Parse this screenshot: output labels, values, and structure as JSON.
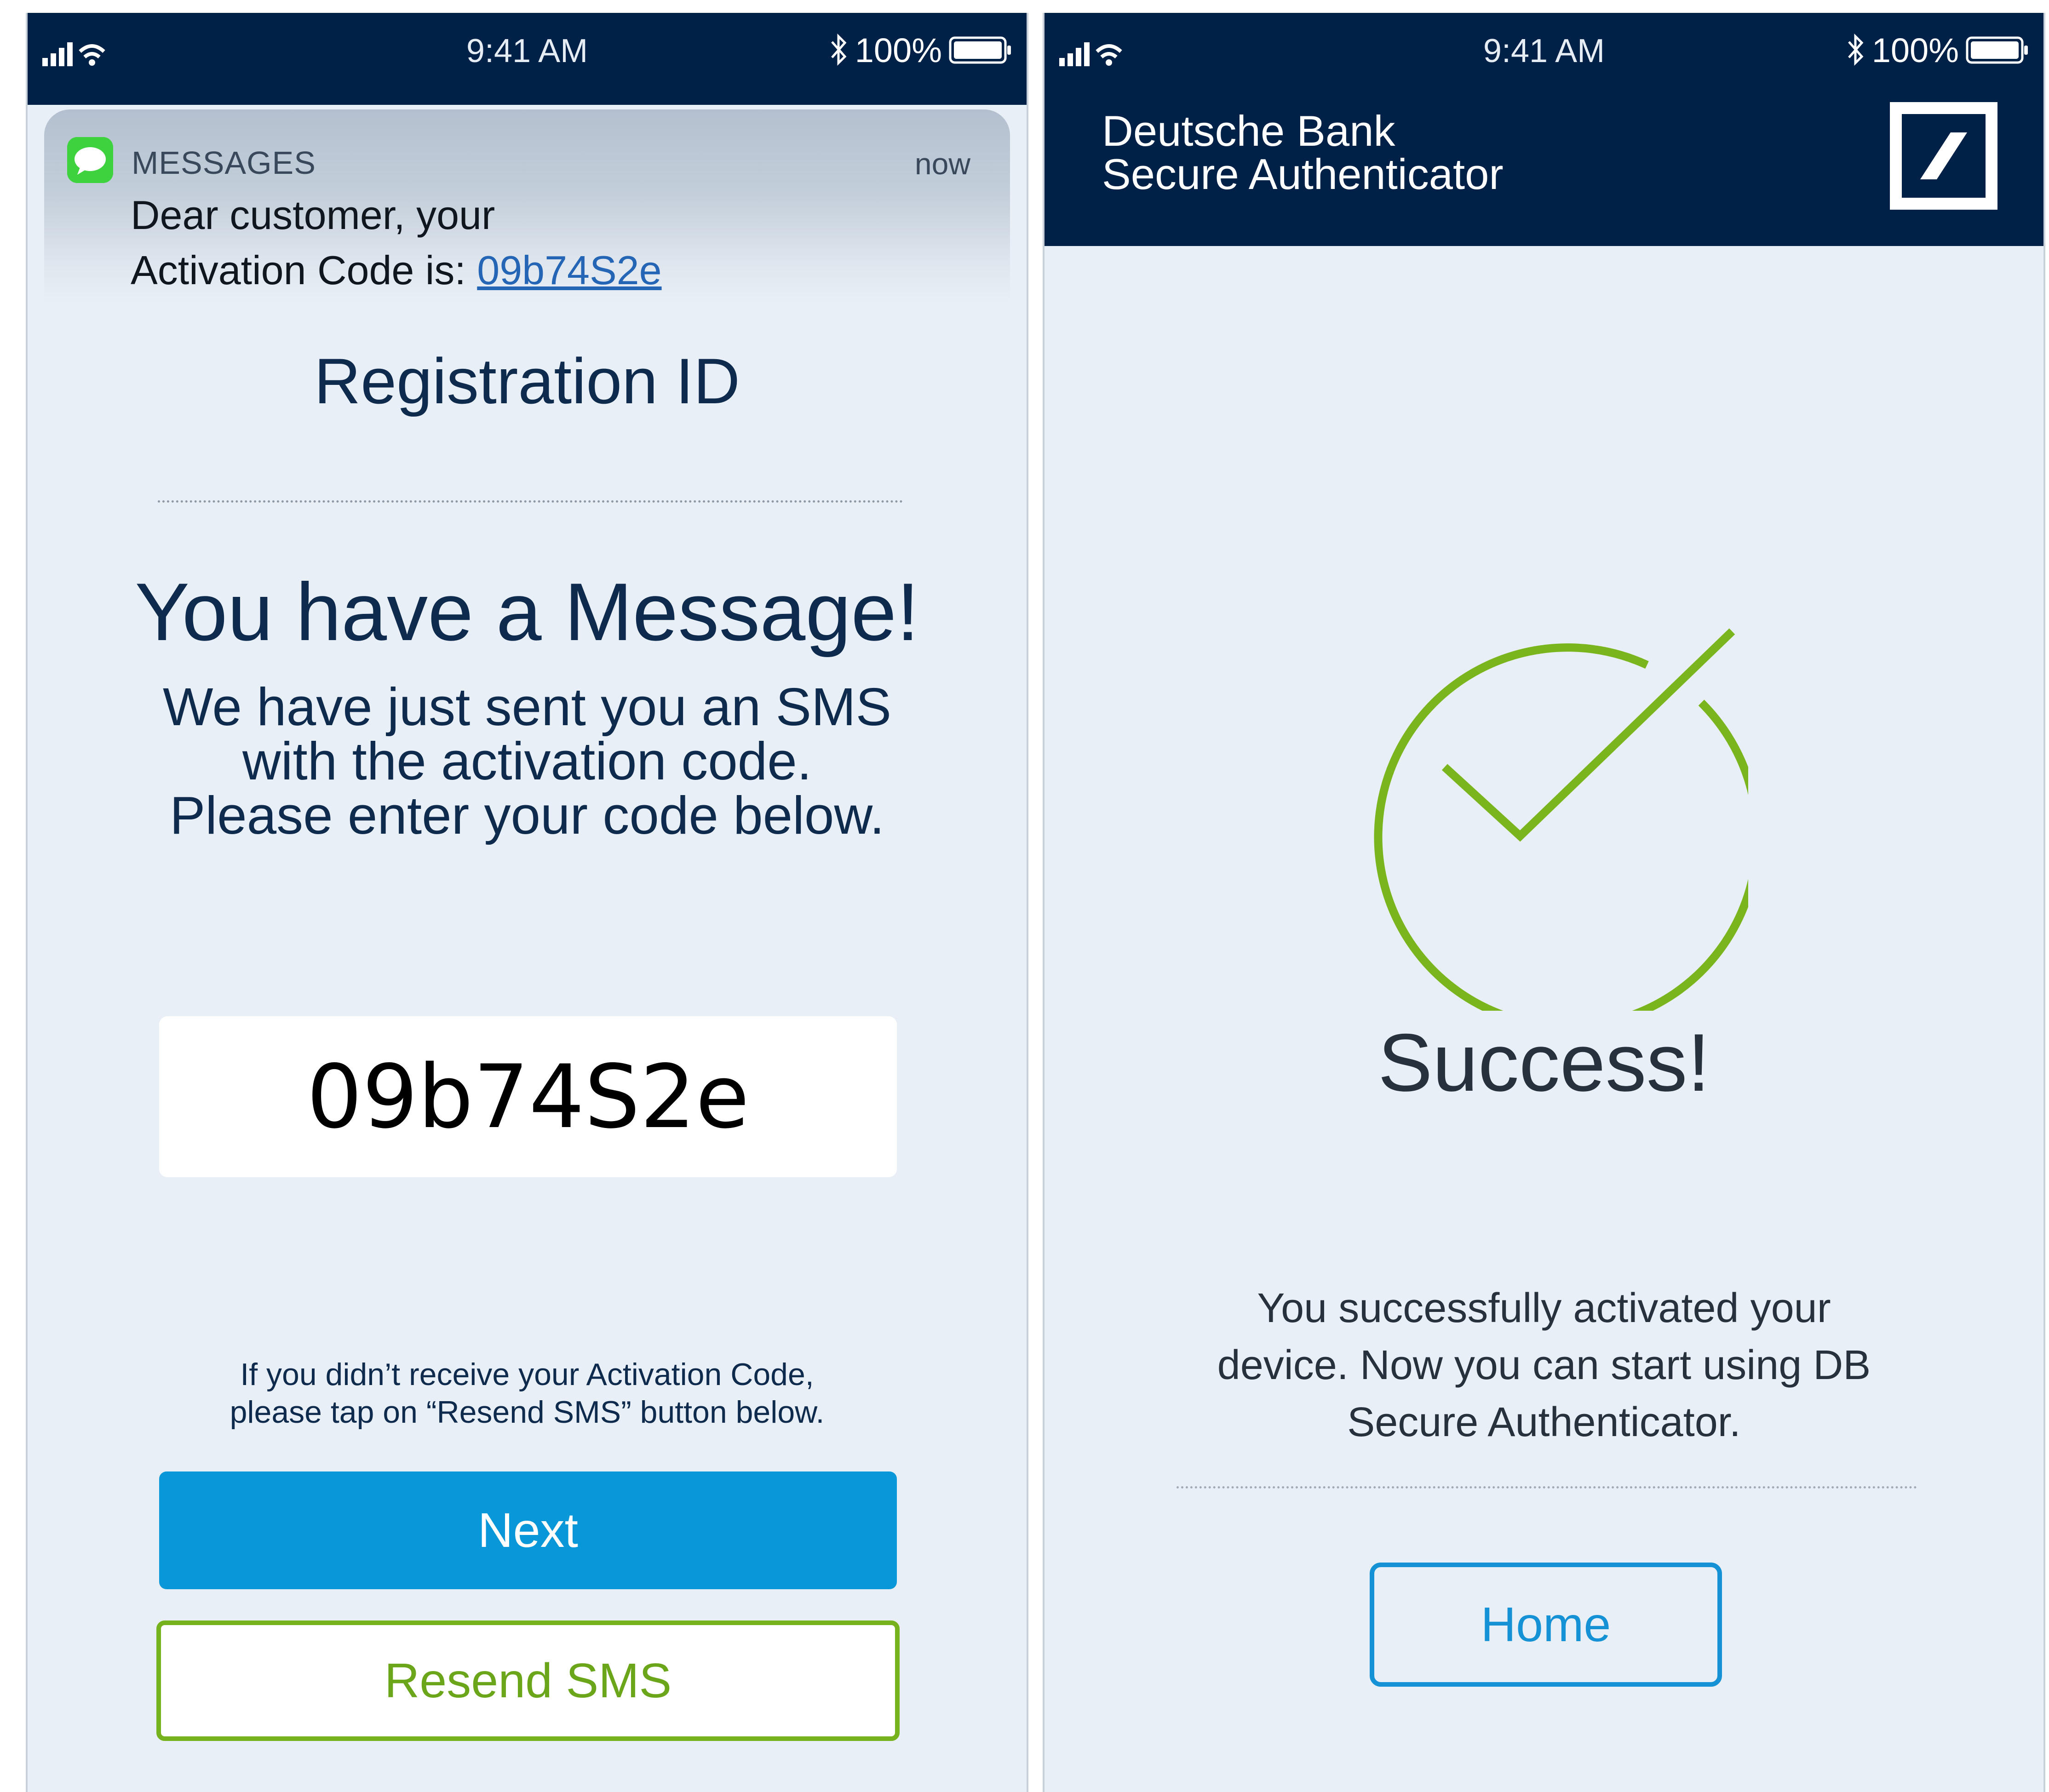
{
  "left_screen": {
    "status_bar": {
      "time": "9:41 AM",
      "battery": "100%",
      "icons": [
        "signal-icon",
        "wifi-icon",
        "bluetooth-icon",
        "battery-icon"
      ]
    },
    "notification": {
      "app_name": "MESSAGES",
      "time": "now",
      "line1": "Dear customer, your",
      "line2_prefix": "Activation Code is: ",
      "code": "09b74S2e",
      "icon": "messages-app-icon"
    },
    "registration_title": "Registration ID",
    "headline": "You have a Message!",
    "subtext": {
      "line1": "We have just sent you an SMS",
      "line2": "with the activation code.",
      "line3": "Please enter your code below."
    },
    "activation_code_value": "09b74S2e",
    "resend_info": {
      "line1": "If you didn’t receive your Activation Code,",
      "line2": "please tap on “Resend SMS” button below."
    },
    "next_label": "Next",
    "resend_label": "Resend SMS"
  },
  "right_screen": {
    "status_bar": {
      "time": "9:41 AM",
      "battery": "100%"
    },
    "brand": {
      "line1": "Deutsche Bank",
      "line2": "Secure Authenticator",
      "logo": "deutsche-bank-logo"
    },
    "success_title": "Success!",
    "success_text": {
      "line1": "You successfully activated your",
      "line2": "device. Now you can start using DB",
      "line3": "Secure Authenticator."
    },
    "home_label": "Home"
  },
  "colors": {
    "navy": "#002147",
    "background": "#e9eff6",
    "primary_blue": "#0898d9",
    "green": "#75b21d",
    "link_blue": "#2466b5"
  }
}
